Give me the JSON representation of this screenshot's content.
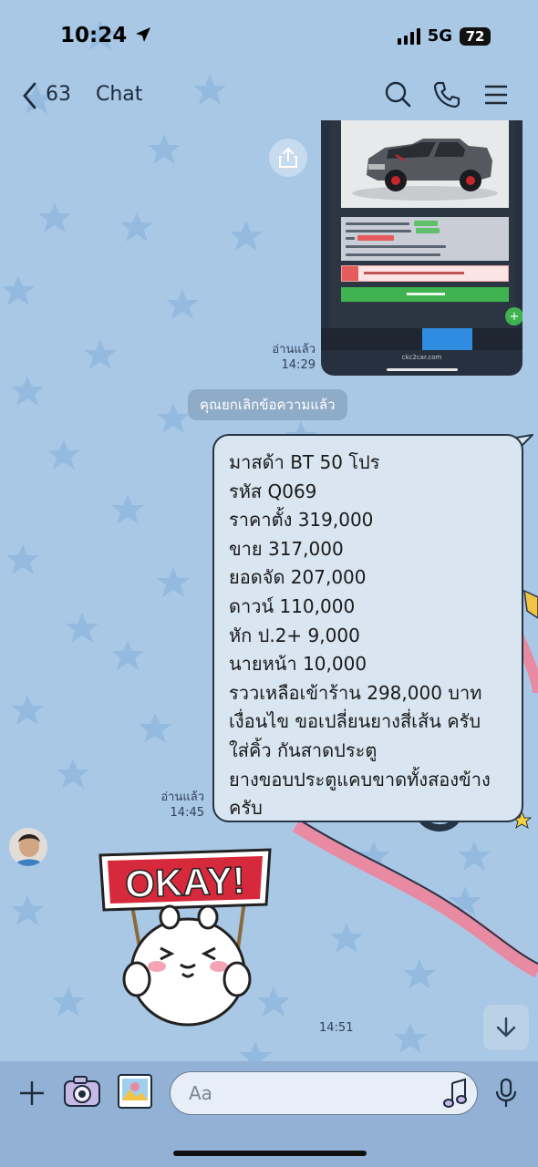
{
  "status_bar": {
    "time": "10:24",
    "network": "5G",
    "battery": "72"
  },
  "header": {
    "unread_count": "63",
    "title": "Chat"
  },
  "messages": {
    "screenshot_read": "อ่านแล้ว",
    "screenshot_time": "14:29",
    "screenshot_url": "ckc2car.com",
    "system_notice": "คุณยกเลิกข้อความแล้ว",
    "text_read": "อ่านแล้ว",
    "text_time": "14:45",
    "text_lines": [
      "มาสด้า BT 50 โปร",
      "รหัส Q069",
      "ราคาตั้ง 319,000",
      "ขาย 317,000",
      "ยอดจัด 207,000",
      "ดาวน์ 110,000",
      "หัก ป.2+ 9,000",
      "นายหน้า 10,000",
      "รววเหลือเข้าร้าน 298,000 บาท",
      "เงื่อนไข ขอเปลี่ยนยางสี่เส้น ครับ",
      "ใส่คิ้ว กันสาดประตู",
      "ยางขอบประตูแคบขาดทั้งสองข้าง",
      "ครับ"
    ],
    "sticker_text": "OKAY!",
    "sticker_time": "14:51"
  },
  "input": {
    "placeholder": "Aa"
  },
  "colors": {
    "background": "#a9c8e6",
    "bubble": "#d9e5f1",
    "input_bar": "#92b1d5",
    "system_pill": "#8eabc7"
  },
  "icons": [
    "back-chevron-icon",
    "search-icon",
    "phone-icon",
    "menu-icon",
    "share-icon",
    "add-icon",
    "camera-icon",
    "photo-icon",
    "music-icon",
    "microphone-icon",
    "arrow-down-icon"
  ]
}
